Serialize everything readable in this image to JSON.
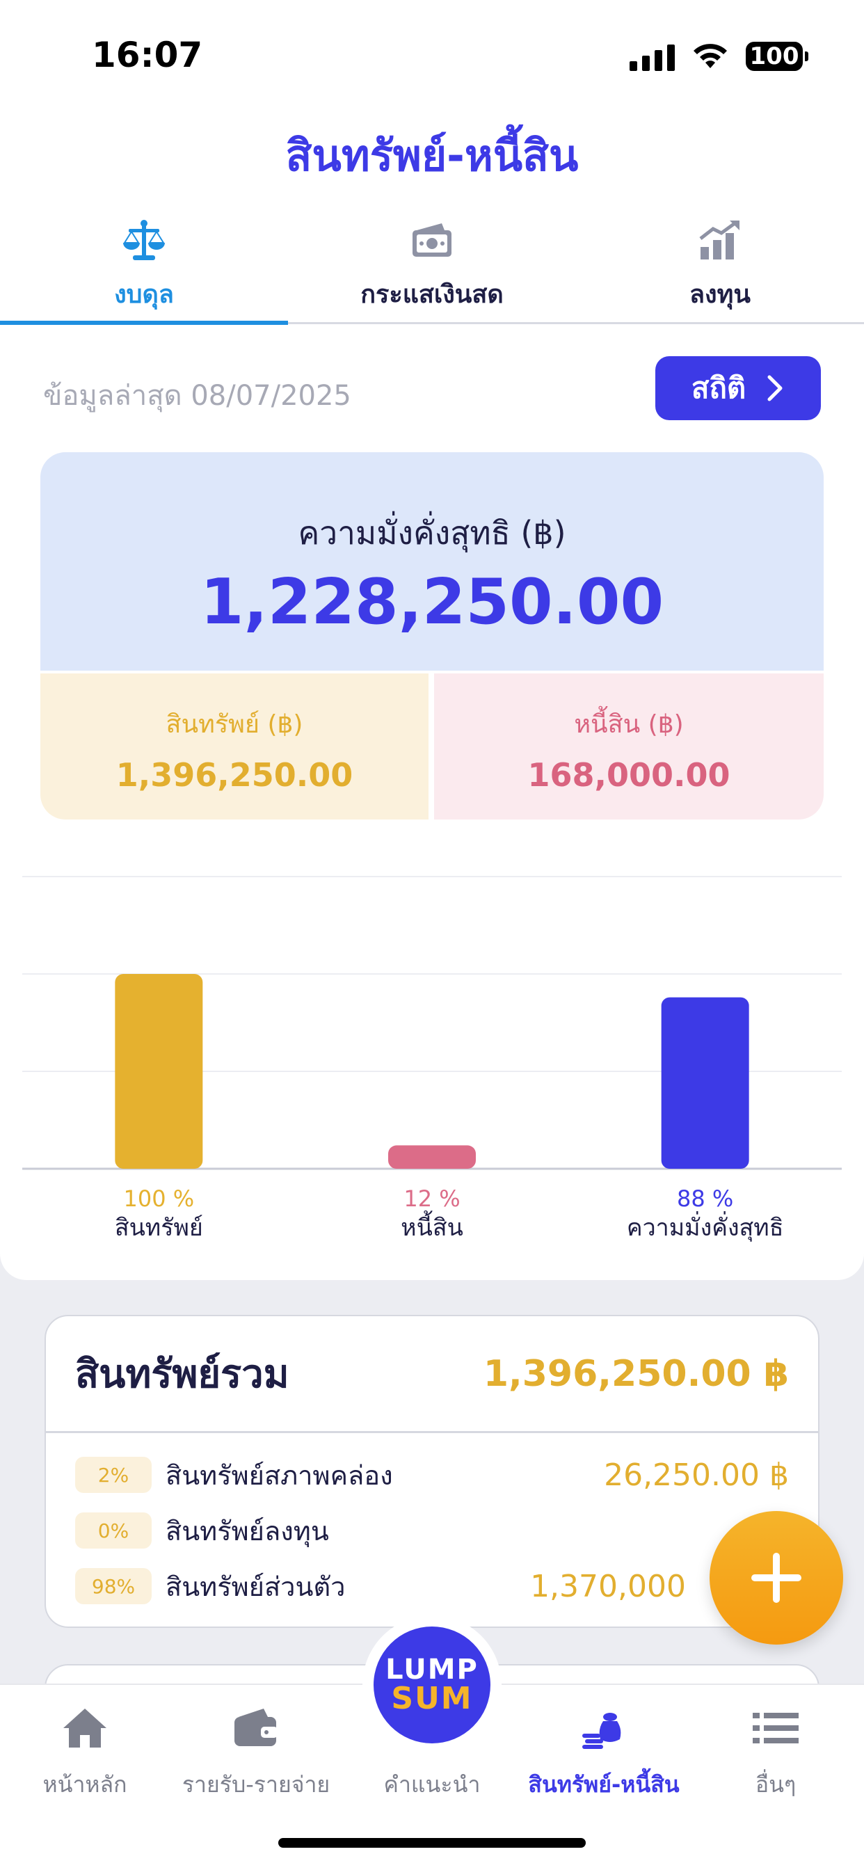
{
  "status_bar": {
    "time": "16:07",
    "battery": "100"
  },
  "page_title": "สินทรัพย์-หนี้สิน",
  "tabs": [
    {
      "label": "งบดุล",
      "icon": "balance-scale-icon",
      "active": true
    },
    {
      "label": "กระแสเงินสด",
      "icon": "cash-icon",
      "active": false
    },
    {
      "label": "ลงทุน",
      "icon": "growth-chart-icon",
      "active": false
    }
  ],
  "updated_text": "ข้อมูลล่าสุด 08/07/2025",
  "stats_button": "สถิติ",
  "net_worth": {
    "label": "ความมั่งคั่งสุทธิ (฿)",
    "value": "1,228,250.00",
    "assets_label": "สินทรัพย์ (฿)",
    "assets_value": "1,396,250.00",
    "liabilities_label": "หนี้สิน (฿)",
    "liabilities_value": "168,000.00"
  },
  "chart_data": {
    "type": "bar",
    "categories": [
      "สินทรัพย์",
      "หนี้สิน",
      "ความมั่งคั่งสุทธิ"
    ],
    "values": [
      100,
      12,
      88
    ],
    "value_labels": [
      "100 %",
      "12 %",
      "88 %"
    ],
    "colors": [
      "#E5B12F",
      "#DC6C88",
      "#3D3AE6"
    ],
    "ylim": [
      0,
      150
    ],
    "grid": true
  },
  "asset_summary": {
    "title": "สินทรัพย์รวม",
    "total": "1,396,250.00 ฿",
    "rows": [
      {
        "pct": "2%",
        "label": "สินทรัพย์สภาพคล่อง",
        "value": "26,250.00 ฿"
      },
      {
        "pct": "0%",
        "label": "สินทรัพย์ลงทุน",
        "value": ""
      },
      {
        "pct": "98%",
        "label": "สินทรัพย์ส่วนตัว",
        "value": "1,370,000"
      }
    ]
  },
  "bottom_nav": {
    "items": [
      {
        "label": "หน้าหลัก",
        "icon": "home-icon"
      },
      {
        "label": "รายรับ-รายจ่าย",
        "icon": "wallet-icon"
      },
      {
        "label": "คำแนะนำ",
        "icon": "lumpsum-logo"
      },
      {
        "label": "สินทรัพย์-หนี้สิน",
        "icon": "money-bag-icon",
        "active": true
      },
      {
        "label": "อื่นๆ",
        "icon": "menu-list-icon"
      }
    ],
    "logo_line1": "LUMP",
    "logo_line2": "SUM"
  },
  "colors": {
    "primary": "#3D3AE6",
    "accent_blue": "#1E8FE0",
    "gold": "#E2AE2F",
    "pink": "#D9637F"
  }
}
